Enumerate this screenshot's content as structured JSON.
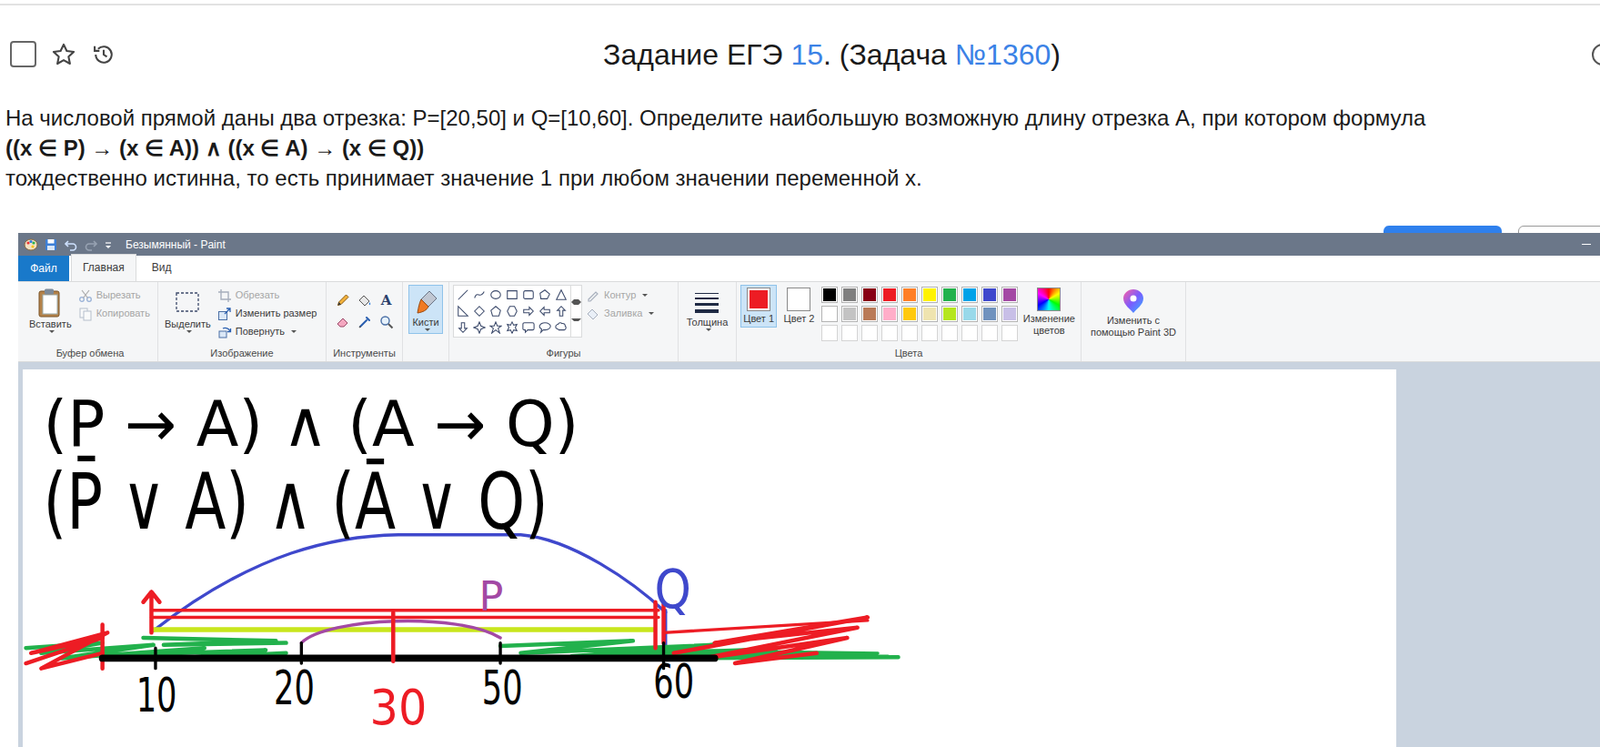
{
  "page": {
    "checked": false,
    "starred": false,
    "title": [
      {
        "text": "Задание ЕГЭ ",
        "kind": "plain"
      },
      {
        "text": "15",
        "kind": "link"
      },
      {
        "text": ". (Задача ",
        "kind": "plain"
      },
      {
        "text": "№1360",
        "kind": "link"
      },
      {
        "text": ")",
        "kind": "plain"
      }
    ],
    "task": "На числовой прямой даны два отрезка: P=[20,50] и Q=[10,60]. Определите наибольшую возможную длину отрезка A, при котором формула",
    "formula": "((x ∈ P) → (x ∈ A)) ∧ ((x ∈ A) → (x ∈ Q))",
    "note": "тождественно истинна, то есть принимает значение 1 при любом значении переменной x."
  },
  "window": {
    "title": "Безымянный - Paint"
  },
  "tabs": [
    {
      "label": "Файл",
      "selected": false,
      "kind": "file"
    },
    {
      "label": "Главная",
      "selected": true,
      "kind": "tab"
    },
    {
      "label": "Вид",
      "selected": false,
      "kind": "tab"
    }
  ],
  "ribbon": {
    "clipboard": {
      "label": "Буфер обмена",
      "paste": "Вставить",
      "cut": {
        "text": "Вырезать",
        "disabled": true
      },
      "copy": {
        "text": "Копировать",
        "disabled": true
      }
    },
    "image": {
      "label": "Изображение",
      "select": "Выделить",
      "crop": {
        "text": "Обрезать",
        "disabled": true
      },
      "resize": {
        "text": "Изменить размер",
        "disabled": false
      },
      "rotate": {
        "text": "Повернуть",
        "disabled": false
      }
    },
    "tools": {
      "label": "Инструменты",
      "text_tool": "A"
    },
    "brushes": {
      "text": "Кисти",
      "selected": true
    },
    "shapes": {
      "label": "Фигуры",
      "outline": {
        "text": "Контур",
        "disabled": true
      },
      "fill": {
        "text": "Заливка",
        "disabled": true
      }
    },
    "size": {
      "text": "Толщина"
    },
    "colors": {
      "label": "Цвета",
      "color1": {
        "text": "Цвет 1",
        "color": "#ed1c24",
        "selected": true
      },
      "color2": {
        "text": "Цвет 2",
        "color": "#ffffff",
        "selected": false
      },
      "palette": [
        {
          "color": "#000000",
          "empty": false
        },
        {
          "color": "#7f7f7f",
          "empty": false
        },
        {
          "color": "#880015",
          "empty": false
        },
        {
          "color": "#ed1c24",
          "empty": false
        },
        {
          "color": "#ff7f27",
          "empty": false
        },
        {
          "color": "#fff200",
          "empty": false
        },
        {
          "color": "#22b14c",
          "empty": false
        },
        {
          "color": "#00a2e8",
          "empty": false
        },
        {
          "color": "#3f48cc",
          "empty": false
        },
        {
          "color": "#a349a4",
          "empty": false
        },
        {
          "color": "#ffffff",
          "empty": false
        },
        {
          "color": "#c3c3c3",
          "empty": false
        },
        {
          "color": "#b97a57",
          "empty": false
        },
        {
          "color": "#ffaec9",
          "empty": false
        },
        {
          "color": "#ffc90e",
          "empty": false
        },
        {
          "color": "#efe4b0",
          "empty": false
        },
        {
          "color": "#b5e61d",
          "empty": false
        },
        {
          "color": "#99d9ea",
          "empty": false
        },
        {
          "color": "#7092be",
          "empty": false
        },
        {
          "color": "#c8bfe7",
          "empty": false
        },
        {
          "color": "#ffffff",
          "empty": true
        },
        {
          "color": "#ffffff",
          "empty": true
        },
        {
          "color": "#ffffff",
          "empty": true
        },
        {
          "color": "#ffffff",
          "empty": true
        },
        {
          "color": "#ffffff",
          "empty": true
        },
        {
          "color": "#ffffff",
          "empty": true
        },
        {
          "color": "#ffffff",
          "empty": true
        },
        {
          "color": "#ffffff",
          "empty": true
        },
        {
          "color": "#ffffff",
          "empty": true
        },
        {
          "color": "#ffffff",
          "empty": true
        }
      ],
      "edit": "Изменение цветов"
    },
    "paint3d": {
      "text": "Изменить с помощью Paint 3D"
    }
  },
  "canvas": {
    "formula": [
      "(P → A) ∧ (A → Q)",
      "(P̄ ∨ A) ∧ (Ā ∨ Q)"
    ],
    "labels": [
      {
        "text": "10",
        "color": "#000000"
      },
      {
        "text": "20",
        "color": "#000000"
      },
      {
        "text": "30",
        "color": "#ed1c24"
      },
      {
        "text": "50",
        "color": "#000000"
      },
      {
        "text": "60",
        "color": "#000000"
      },
      {
        "text": "P",
        "color": "#a349a4"
      },
      {
        "text": "Q",
        "color": "#3f48cc"
      }
    ]
  }
}
